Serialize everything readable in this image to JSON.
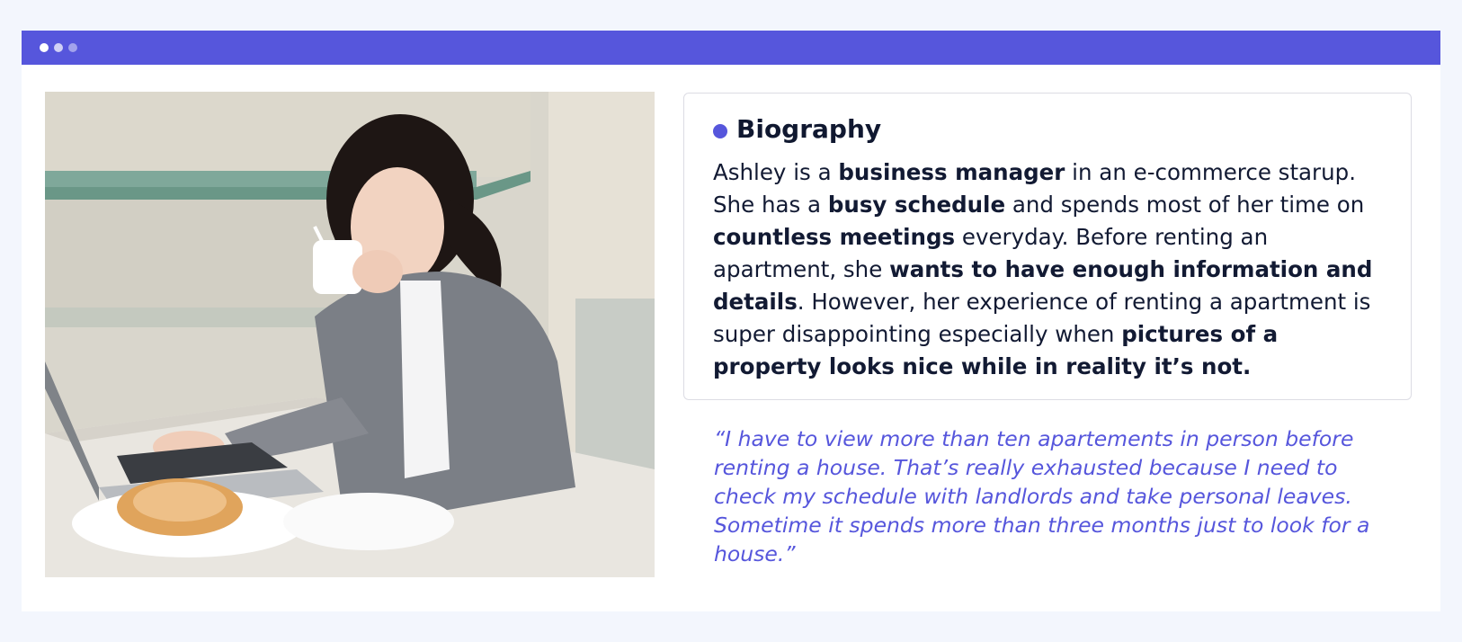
{
  "window": {
    "controls": [
      "dot-1",
      "dot-2",
      "dot-3"
    ],
    "accent_color": "#5656dc"
  },
  "photo": {
    "description_icon": "photo-woman-working-laptop"
  },
  "biography": {
    "title": "Biography",
    "segments": [
      {
        "text": "Ashley is a ",
        "bold": false
      },
      {
        "text": "business manager",
        "bold": true
      },
      {
        "text": " in an e-commerce starup. She has a ",
        "bold": false
      },
      {
        "text": "busy schedule",
        "bold": true
      },
      {
        "text": " and spends most of her time on ",
        "bold": false
      },
      {
        "text": "countless meetings",
        "bold": true
      },
      {
        "text": " everyday. Before renting an apartment, she ",
        "bold": false
      },
      {
        "text": "wants to have enough information and details",
        "bold": true
      },
      {
        "text": ". However, her experience of renting a apartment is super disappointing especially when ",
        "bold": false
      },
      {
        "text": "pictures of a property looks nice while in reality it’s not.",
        "bold": true
      }
    ]
  },
  "quote": {
    "text": "“I have to view more than ten apartements in person before renting a house. That’s really exhausted because I need to check my schedule with landlords and take personal leaves. Sometime it spends more than three months just to look for a house.”"
  }
}
